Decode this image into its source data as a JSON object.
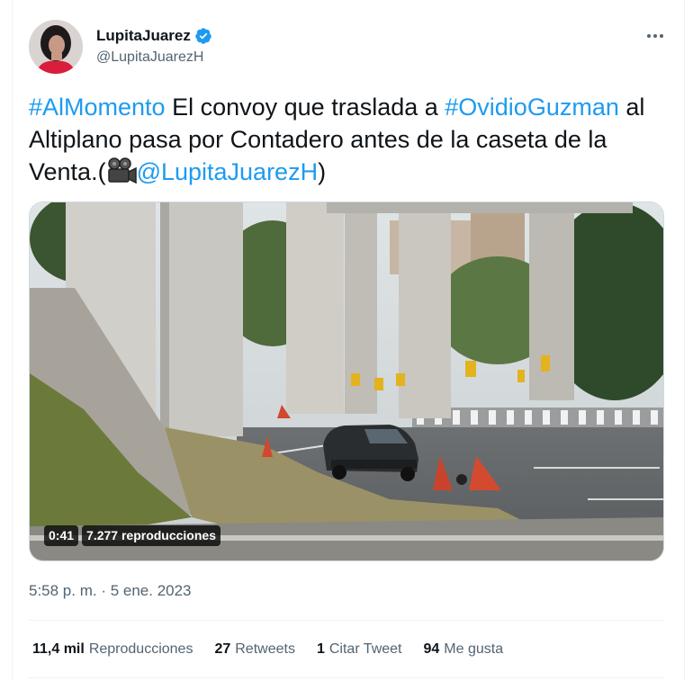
{
  "author": {
    "display_name": "LupitaJuarez",
    "handle": "@LupitaJuarezH",
    "verified": true,
    "avatar_icon": "profile-photo"
  },
  "more_icon": "more-horizontal-icon",
  "tweet": {
    "hashtag1": "#AlMomento",
    "text1": " El convoy que traslada a ",
    "hashtag2": "#OvidioGuzman",
    "text2": " al Altiplano pasa por Contadero antes de la caseta de la Venta.(",
    "emoji_icon": "movie-camera-icon",
    "mention": "@LupitaJuarezH",
    "text3": ")"
  },
  "media": {
    "duration": "0:41",
    "views": "7.277 reproducciones"
  },
  "timestamp": "5:58 p. m. · 5 ene. 2023",
  "stats": [
    {
      "value": "11,4 mil",
      "label": "Reproducciones"
    },
    {
      "value": "27",
      "label": "Retweets"
    },
    {
      "value": "1",
      "label": "Citar Tweet"
    },
    {
      "value": "94",
      "label": "Me gusta"
    }
  ],
  "colors": {
    "link": "#1d9bf0",
    "secondary_text": "#536471",
    "primary_text": "#0f1419"
  }
}
